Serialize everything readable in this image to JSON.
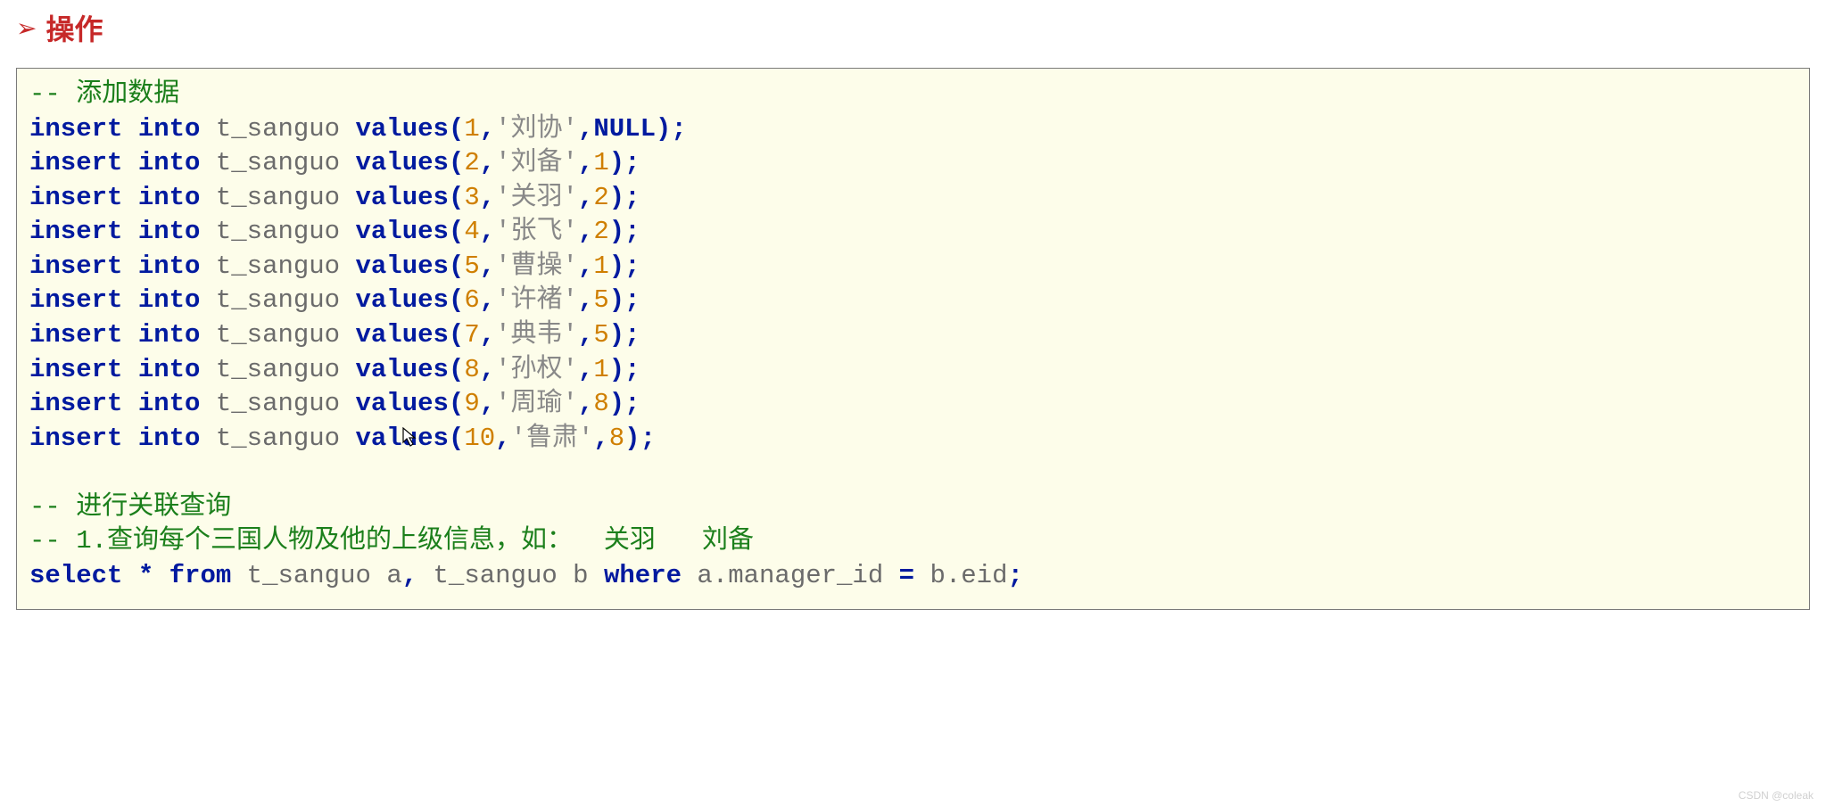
{
  "heading": {
    "bullet": "➢",
    "text": "操作"
  },
  "comments": {
    "c1": "-- 添加数据",
    "c2": "-- 进行关联查询",
    "c3": "-- 1.查询每个三国人物及他的上级信息，如：  关羽   刘备"
  },
  "kw": {
    "insert": "insert",
    "into": "into",
    "values": "values",
    "null": "NULL",
    "select": "select",
    "from": "from",
    "where": "where"
  },
  "ident": {
    "table": "t_sanguo",
    "alias_a": "a",
    "alias_b": "b",
    "col_manager_id": "a.manager_id",
    "col_eid": "b.eid",
    "star": "*",
    "eq": "="
  },
  "rows": [
    {
      "id": "1",
      "name": "'刘协'",
      "mgr": null
    },
    {
      "id": "2",
      "name": "'刘备'",
      "mgr": "1"
    },
    {
      "id": "3",
      "name": "'关羽'",
      "mgr": "2"
    },
    {
      "id": "4",
      "name": "'张飞'",
      "mgr": "2"
    },
    {
      "id": "5",
      "name": "'曹操'",
      "mgr": "1"
    },
    {
      "id": "6",
      "name": "'许褚'",
      "mgr": "5"
    },
    {
      "id": "7",
      "name": "'典韦'",
      "mgr": "5"
    },
    {
      "id": "8",
      "name": "'孙权'",
      "mgr": "1"
    },
    {
      "id": "9",
      "name": "'周瑜'",
      "mgr": "8"
    },
    {
      "id": "10",
      "name": "'鲁肃'",
      "mgr": "8"
    }
  ],
  "punct": {
    "lparen": "(",
    "rparen_semi": ");",
    "comma": ",",
    "semi": ";",
    "spc": " "
  },
  "watermark": "CSDN @coleak"
}
